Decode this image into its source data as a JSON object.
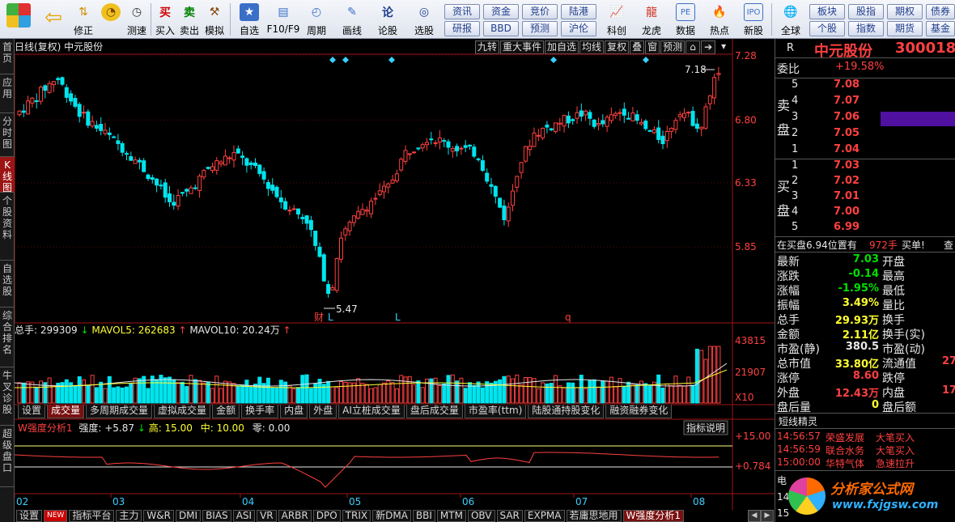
{
  "toolbar": {
    "buttons": [
      "修正",
      "测速",
      "买入",
      "卖出",
      "模拟",
      "自选",
      "F10/F9",
      "周期",
      "画线",
      "论股",
      "选股",
      "科创",
      "龙虎",
      "数据",
      "热点",
      "新股",
      "全球"
    ],
    "mini_top": [
      "资讯",
      "资金",
      "竞价",
      "陆港",
      "板块",
      "股指",
      "期权",
      "债券"
    ],
    "mini_bottom": [
      "研报",
      "BBD",
      "预测",
      "沪伦",
      "个股",
      "指数",
      "期货",
      "基金"
    ]
  },
  "left_tabs": [
    "首页",
    "应用",
    "分时图",
    "K线图",
    "个股资料",
    "自选股",
    "综合排名",
    "牛叉诊股",
    "超级盘口"
  ],
  "chart": {
    "title": "日线(复权)  中元股份",
    "toolbar": [
      "九转",
      "重大事件",
      "加自选",
      "均线",
      "复权",
      "叠",
      "窗",
      "预测"
    ],
    "price_ticks": [
      "7.28",
      "6.80",
      "6.33",
      "5.85"
    ],
    "high_label": "7.18",
    "low_label": "5.47",
    "event_marks": [
      "财",
      "L",
      "L",
      "q"
    ],
    "volume_header": {
      "total": "总手: 299309",
      "mavol5": "MAVOL5: 262683",
      "mavol10": "MAVOL10: 20.24万"
    },
    "volume_ticks": [
      "43815",
      "21907",
      "X10"
    ],
    "tabs": [
      "设置",
      "成交量",
      "多周期成交量",
      "虚拟成交量",
      "金额",
      "换手率",
      "内盘",
      "外盘",
      "AI立桩成交量",
      "盘后成交量",
      "市盈率(ttm)",
      "陆股通持股变化",
      "融资融券变化"
    ],
    "indicator_header": {
      "name": "W强度分析1",
      "strength": "强度: +5.87",
      "high": "高: 15.00",
      "mid": "中: 10.00",
      "zero": "零: 0.00"
    },
    "indicator_button": "指标说明",
    "indicator_ticks": [
      "+15.00",
      "+0.784"
    ],
    "date_ticks": [
      "02",
      "03",
      "04",
      "05",
      "06",
      "07",
      "08"
    ],
    "bottom_tabs": [
      "设置",
      "NEW",
      "指标平台",
      "主力",
      "W&R",
      "DMI",
      "BIAS",
      "ASI",
      "VR",
      "ARBR",
      "DPO",
      "TRIX",
      "新DMA",
      "BBI",
      "MTM",
      "OBV",
      "SAR",
      "EXPMA",
      "若庸思地用",
      "W强度分析1"
    ]
  },
  "quote": {
    "tag": "R",
    "name": "中元股份",
    "code": "300018",
    "weibi_label": "委比",
    "weibi_value": "+19.58%",
    "sell_label": "卖盘",
    "buy_label": "买盘",
    "asks": [
      {
        "level": "5",
        "price": "7.08"
      },
      {
        "level": "4",
        "price": "7.07"
      },
      {
        "level": "3",
        "price": "7.06"
      },
      {
        "level": "2",
        "price": "7.05"
      },
      {
        "level": "1",
        "price": "7.04"
      }
    ],
    "bids": [
      {
        "level": "1",
        "price": "7.03"
      },
      {
        "level": "2",
        "price": "7.02"
      },
      {
        "level": "3",
        "price": "7.01"
      },
      {
        "level": "4",
        "price": "7.00"
      },
      {
        "level": "5",
        "price": "6.99"
      }
    ],
    "tip": {
      "text": "在买盘6.94位置有",
      "count": "972手",
      "act": "买单!",
      "more": "查"
    },
    "stats_left": [
      {
        "label": "最新",
        "value": "7.03",
        "color": "#00e000"
      },
      {
        "label": "涨跌",
        "value": "-0.14",
        "color": "#00e000"
      },
      {
        "label": "涨幅",
        "value": "-1.95%",
        "color": "#00e000"
      },
      {
        "label": "振幅",
        "value": "3.49%",
        "color": "#ffff30"
      },
      {
        "label": "总手",
        "value": "29.93万",
        "color": "#ffff30"
      },
      {
        "label": "金额",
        "value": "2.11亿",
        "color": "#ffff30"
      },
      {
        "label": "市盈(静)",
        "value": "380.5",
        "color": "#e8e8e8"
      },
      {
        "label": "总市值",
        "value": "33.80亿",
        "color": "#ffff30"
      },
      {
        "label": "涨停",
        "value": "8.60",
        "color": "#ff4040"
      },
      {
        "label": "外盘",
        "value": "12.43万",
        "color": "#ff4040"
      },
      {
        "label": "盘后量",
        "value": "0",
        "color": "#ffff30"
      }
    ],
    "stats_right": [
      {
        "label": "开盘",
        "value": ""
      },
      {
        "label": "最高",
        "value": ""
      },
      {
        "label": "最低",
        "value": ""
      },
      {
        "label": "量比",
        "value": ""
      },
      {
        "label": "换手",
        "value": ""
      },
      {
        "label": "换手(实)",
        "value": ""
      },
      {
        "label": "市盈(动)",
        "value": ""
      },
      {
        "label": "流通值",
        "value": "27"
      },
      {
        "label": "跌停",
        "value": ""
      },
      {
        "label": "内盘",
        "value": "17"
      },
      {
        "label": "盘后额",
        "value": ""
      }
    ],
    "tickers_title": "短线精灵",
    "tickers": [
      {
        "time": "14:56:57",
        "stock": "荣盛发展",
        "event": "大笔买入"
      },
      {
        "time": "14:56:59",
        "stock": "联合水务",
        "event": "大笔买入"
      },
      {
        "time": "15:00:00",
        "stock": "华特气体",
        "event": "急速拉升"
      }
    ],
    "footer_partial": [
      "电",
      "14",
      "15"
    ]
  },
  "watermark": {
    "title": "分析家公式网",
    "url": "www.fxjgsw.com"
  },
  "colors": {
    "up": "#ff4040",
    "down": "#00e5ee",
    "price_line": "#a01414",
    "selected_row": "#5010a0"
  }
}
